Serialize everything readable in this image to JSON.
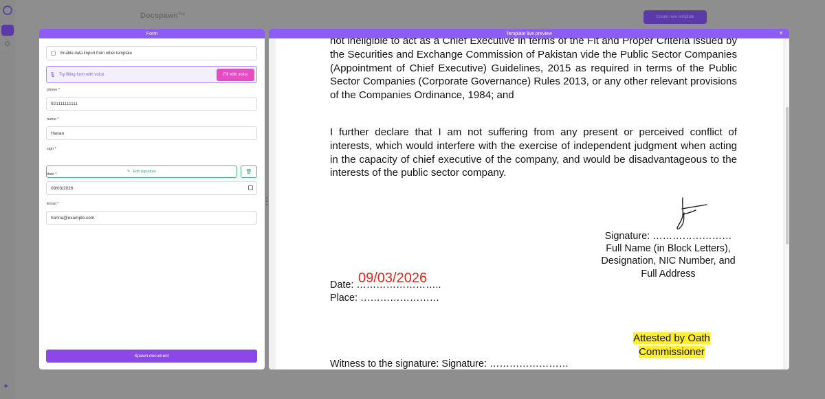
{
  "app": {
    "title": "Docspawn™",
    "create_button": "Create new template"
  },
  "form_panel": {
    "title": "Form",
    "import_label": "Enable data import from other template",
    "voice_prompt": "Try filling form with voice",
    "voice_button": "Fill with voice",
    "fields": {
      "phone": {
        "label": "phone *",
        "value": "921111111111"
      },
      "name": {
        "label": "name *",
        "value": "Hanan"
      },
      "sign": {
        "label": "sign *",
        "button": "Edit signature"
      },
      "date": {
        "label": "date *",
        "value": "09/03/2026"
      },
      "email": {
        "label": "Email *",
        "value": "hanna@example.com"
      }
    },
    "spawn_button": "Spawn document"
  },
  "preview_panel": {
    "title": "Template live preview",
    "close": "×",
    "doc": {
      "paragraph1": "not ineligible to act as a Chief Executive in terms of the Fit and Proper Criteria issued by the Securities and Exchange Commission of Pakistan vide the Public Sector Companies (Appointment of Chief Executive) Guidelines, 2015 as required in terms of the Public Sector Companies (Corporate Governance) Rules 2013, or any other relevant provisions of the Companies Ordinance, 1984; and",
      "paragraph2": "I further declare that I am not suffering from any present or perceived conflict of interests, which would interfere with the exercise of independent judgment when acting in the capacity of chief executive of the company, and would be disadvantageous to the interests of the public sector company.",
      "signature_line": "Signature: ……………………",
      "full_name": "Full Name (in Block Letters),",
      "designation": "Designation, NIC Number, and",
      "full_address": "Full Address",
      "date_line": "Date: ……………………..",
      "place_line": "Place: ……………………",
      "date_value": "09/03/2026",
      "attested1": "Attested by Oath",
      "attested2": "Commissioner",
      "witness": "Witness to the signature: Signature: ……………………"
    }
  }
}
